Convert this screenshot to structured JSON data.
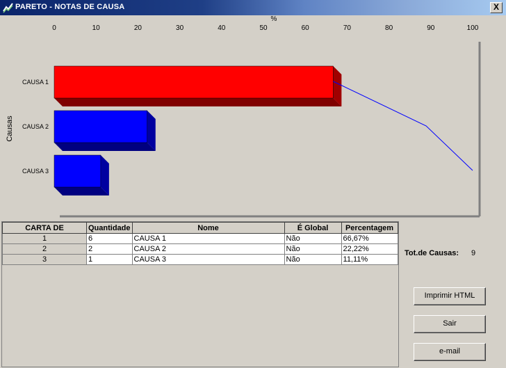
{
  "window": {
    "title": "PARETO - NOTAS DE CAUSA",
    "close_label": "X"
  },
  "chart_data": {
    "type": "bar",
    "orientation": "horizontal",
    "title": "%",
    "ylabel": "Causas",
    "xlim": [
      0,
      100
    ],
    "xticks": [
      "0",
      "10",
      "20",
      "30",
      "40",
      "50",
      "60",
      "70",
      "80",
      "90",
      "100"
    ],
    "categories": [
      "CAUSA 1",
      "CAUSA 2",
      "CAUSA 3"
    ],
    "values": [
      66.67,
      22.22,
      11.11
    ],
    "bar_colors": [
      "#ff0000",
      "#0000ff",
      "#0000ff"
    ],
    "cumulative_line": {
      "values": [
        66.67,
        88.89,
        100
      ],
      "color": "#0000ff"
    },
    "grid": false
  },
  "table": {
    "columns": [
      "CARTA DE",
      "Quantidade",
      "Nome",
      "É Global",
      "Percentagem"
    ],
    "rows": [
      [
        "1",
        "6",
        "CAUSA 1",
        "Não",
        "66,67%"
      ],
      [
        "2",
        "2",
        "CAUSA 2",
        "Não",
        "22,22%"
      ],
      [
        "3",
        "1",
        "CAUSA 3",
        "Não",
        "11,11%"
      ]
    ]
  },
  "totals": {
    "label": "Tot.de Causas:",
    "value": "9"
  },
  "buttons": {
    "print": "Imprimir HTML",
    "exit": "Sair",
    "email": "e-mail"
  }
}
